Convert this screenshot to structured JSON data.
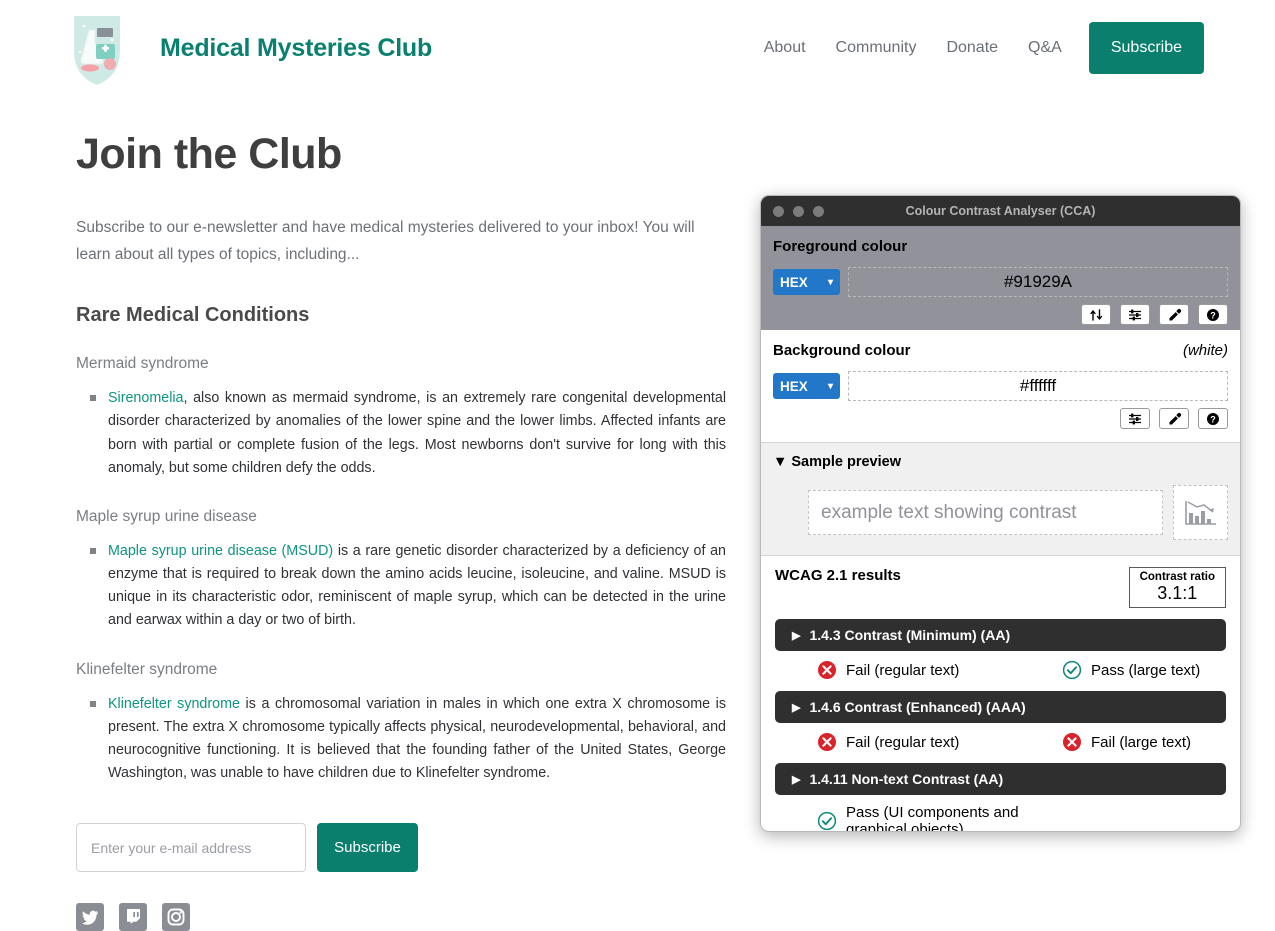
{
  "header": {
    "logo_name": "medical-shield-logo",
    "brand": "Medical Mysteries Club",
    "brand_color": "#0a8070",
    "nav": [
      {
        "label": "About"
      },
      {
        "label": "Community"
      },
      {
        "label": "Donate"
      },
      {
        "label": "Q&A"
      }
    ],
    "subscribe_label": "Subscribe",
    "subscribe_color": "#0a7f6e"
  },
  "main": {
    "page_title": "Join the Club",
    "lede": "Subscribe to our e-newsletter and have medical mysteries delivered to your inbox! You will learn about all types of topics, including...",
    "section_title": "Rare Medical Conditions",
    "conditions": [
      {
        "title": "Mermaid syndrome",
        "link_text": "Sirenomelia",
        "body": ", also known as mermaid syndrome, is an extremely rare congenital developmental disorder characterized by anomalies of the lower spine and the lower limbs. Affected infants are born with partial or complete fusion of the legs. Most newborns don't survive for long with this anomaly, but some children defy the odds."
      },
      {
        "title": "Maple syrup urine disease",
        "link_text": "Maple syrup urine disease (MSUD)",
        "body": " is a rare genetic disorder characterized by a deficiency of an enzyme that is required to break down the amino acids leucine, isoleucine, and valine. MSUD is unique in its characteristic odor, reminiscent of maple syrup, which can be detected in the urine and earwax within a day or two of birth."
      },
      {
        "title": "Klinefelter syndrome",
        "link_text": "Klinefelter syndrome",
        "body": " is a chromosomal variation in males in which one extra X chromosome is present. The extra X chromosome typically affects physical, neurodevelopmental, behavioral, and neurocognitive functioning. It is believed that the founding father of the United States, George Washington, was unable to have children due to Klinefelter syndrome."
      }
    ],
    "link_color": "#0e9483",
    "form": {
      "email_placeholder": "Enter your e-mail address",
      "email_value": "",
      "subscribe_label": "Subscribe"
    },
    "socials": [
      {
        "name": "twitter-icon"
      },
      {
        "name": "twitch-icon"
      },
      {
        "name": "instagram-icon"
      }
    ]
  },
  "cca": {
    "window_title": "Colour Contrast Analyser (CCA)",
    "foreground": {
      "label": "Foreground colour",
      "format": "HEX",
      "value": "#91929A",
      "note": "",
      "buttons": [
        "swap-colours-icon",
        "adjust-sliders-icon",
        "eyedropper-icon",
        "help-icon"
      ]
    },
    "background": {
      "label": "Background colour",
      "format": "HEX",
      "value": "#ffffff",
      "note": "(white)",
      "buttons": [
        "adjust-sliders-icon",
        "eyedropper-icon",
        "help-icon"
      ]
    },
    "sample": {
      "disclosure_label": "Sample preview",
      "disclosure_glyph": "▼",
      "text": "example text showing contrast",
      "thumb_icon": "chart-preview-icon"
    },
    "results": {
      "title": "WCAG 2.1 results",
      "ratio_label": "Contrast ratio",
      "ratio_value": "3.1:1",
      "criteria": [
        {
          "name": "1.4.3 Contrast (Minimum) (AA)",
          "results": [
            {
              "status": "fail",
              "text": "Fail (regular text)"
            },
            {
              "status": "pass",
              "text": "Pass (large text)"
            }
          ]
        },
        {
          "name": "1.4.6 Contrast (Enhanced) (AAA)",
          "results": [
            {
              "status": "fail",
              "text": "Fail (regular text)"
            },
            {
              "status": "fail",
              "text": "Fail (large text)"
            }
          ]
        },
        {
          "name": "1.4.11 Non-text Contrast (AA)",
          "results": [
            {
              "status": "pass",
              "text": "Pass (UI components and graphical objects)"
            }
          ]
        }
      ],
      "fail_color": "#d9232a",
      "pass_color": "#0e8a7c"
    }
  }
}
